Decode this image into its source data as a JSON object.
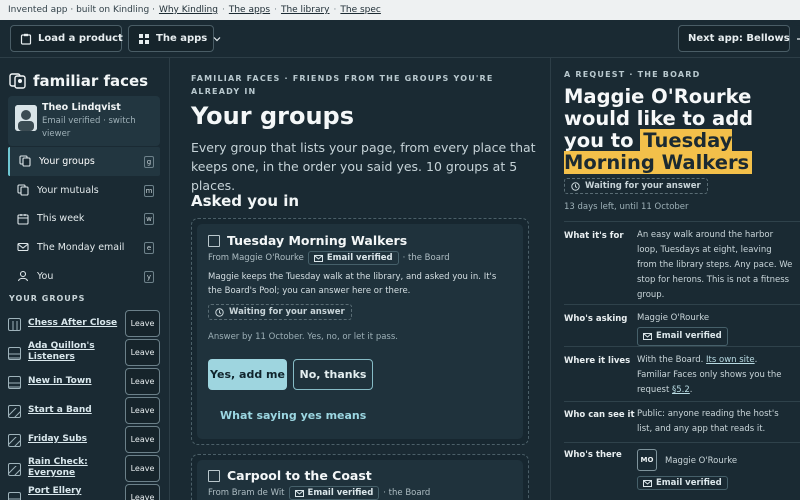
{
  "topbar": {
    "text": "Invented app · built on Kindling ·",
    "links": [
      "Why Kindling",
      "The apps",
      "The library",
      "The spec"
    ]
  },
  "toolbar": {
    "load_product": "Load a product",
    "the_apps": "The apps",
    "next_app": "Next app: Bellows"
  },
  "sidebar": {
    "app_name": "familiar faces",
    "user": {
      "name": "Theo Lindqvist",
      "status": "Email verified · switch viewer"
    },
    "nav": [
      {
        "label": "Your groups",
        "key": "g",
        "icon": "group-icon",
        "active": true
      },
      {
        "label": "Your mutuals",
        "key": "m",
        "icon": "mutuals-icon",
        "active": false
      },
      {
        "label": "This week",
        "key": "w",
        "icon": "calendar-icon",
        "active": false
      },
      {
        "label": "The Monday email",
        "key": "e",
        "icon": "mail-icon",
        "active": false
      },
      {
        "label": "You",
        "key": "y",
        "icon": "person-icon",
        "active": false
      }
    ],
    "groups_heading": "YOUR GROUPS",
    "leave_label": "Leave",
    "groups": [
      {
        "name": "Chess After Close"
      },
      {
        "name": "Ada Quillon's Listeners"
      },
      {
        "name": "New in Town"
      },
      {
        "name": "Start a Band"
      },
      {
        "name": "Friday Subs"
      },
      {
        "name": "Rain Check: Everyone"
      },
      {
        "name": "Port Ellery"
      }
    ]
  },
  "main": {
    "eyebrow": "FAMILIAR FACES · FRIENDS FROM THE GROUPS YOU'RE ALREADY IN",
    "title": "Your groups",
    "intro": "Every group that lists your page, from every place that keeps one, in the order you said yes. 10 groups at 5 places.",
    "asked_heading": "Asked you in",
    "cards": [
      {
        "title": "Tuesday Morning Walkers",
        "from": "From Maggie O'Rourke",
        "verified": "Email verified",
        "place": "· the Board",
        "body": "Maggie keeps the Tuesday walk at the library, and asked you in. It's the Board's Pool; you can answer here or there.",
        "status": "Waiting for your answer",
        "answer_by": "Answer by 11 October. Yes, no, or let it pass.",
        "yes_label": "Yes, add me",
        "no_label": "No, thanks",
        "link_label": "What saying yes means"
      },
      {
        "title": "Carpool to the Coast",
        "from": "From Bram de Wit",
        "verified": "Email verified",
        "place": "· the Board"
      }
    ]
  },
  "panel": {
    "eyebrow": "A REQUEST · THE BOARD",
    "title_pre": "Maggie O'Rourke would like to add you to",
    "title_highlight": "Tuesday Morning Walkers",
    "status": "Waiting for your answer",
    "days_left": "13 days left, until 11 October",
    "rows": {
      "what_label": "What it's for",
      "what_value": "An easy walk around the harbor loop, Tuesdays at eight, leaving from the library steps. Any pace. We stop for herons. This is not a fitness group.",
      "who_label": "Who's asking",
      "who_name": "Maggie O'Rourke",
      "who_verified": "Email verified",
      "where_label": "Where it lives",
      "where_pre": "With the Board.",
      "where_link": "Its own site",
      "where_mid": ". Familiar Faces only shows you the request",
      "where_spec": "§5.2",
      "where_end": ".",
      "see_label": "Who can see it",
      "see_value": "Public: anyone reading the host's list, and any app that reads it.",
      "there_label": "Who's there",
      "there_initials": "MO",
      "there_name": "Maggie O'Rourke",
      "there_verified": "Email verified"
    }
  },
  "colors": {
    "background": "#1a2a33",
    "accent": "#9ed5df",
    "highlight": "#f3c04a"
  }
}
